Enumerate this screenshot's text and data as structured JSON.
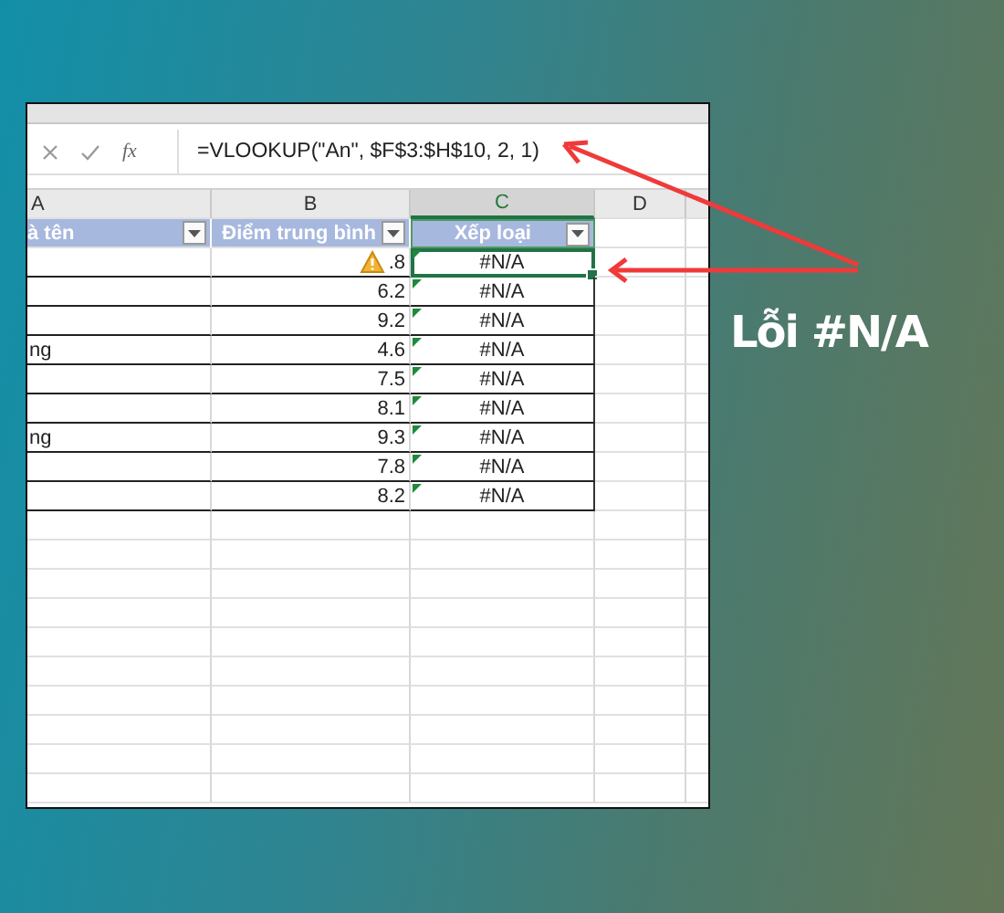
{
  "formula_bar": {
    "function_label": "fx",
    "formula": "=VLOOKUP(\"An\", $F$3:$H$10, 2, 1)"
  },
  "columns": [
    {
      "label": "A",
      "selected": false
    },
    {
      "label": "B",
      "selected": false
    },
    {
      "label": "C",
      "selected": true
    },
    {
      "label": "D",
      "selected": false
    }
  ],
  "header": [
    "à tên",
    "Điểm trung bình",
    "Xếp loại"
  ],
  "rows": [
    {
      "score": ".8",
      "grade": "#N/A",
      "warning": true,
      "selected": true
    },
    {
      "score": "6.2",
      "grade": "#N/A",
      "warning": false,
      "selected": false
    },
    {
      "score": "9.2",
      "grade": "#N/A",
      "warning": false,
      "selected": false
    },
    {
      "name": "ng",
      "score": "4.6",
      "grade": "#N/A",
      "warning": false,
      "selected": false
    },
    {
      "score": "7.5",
      "grade": "#N/A",
      "warning": false,
      "selected": false
    },
    {
      "score": "8.1",
      "grade": "#N/A",
      "warning": false,
      "selected": false
    },
    {
      "name": "ng",
      "score": "9.3",
      "grade": "#N/A",
      "warning": false,
      "selected": false
    },
    {
      "score": "7.8",
      "grade": "#N/A",
      "warning": false,
      "selected": false
    },
    {
      "score": "8.2",
      "grade": "#N/A",
      "warning": false,
      "selected": false
    }
  ],
  "callout": {
    "text": "Lỗi #N/A"
  }
}
